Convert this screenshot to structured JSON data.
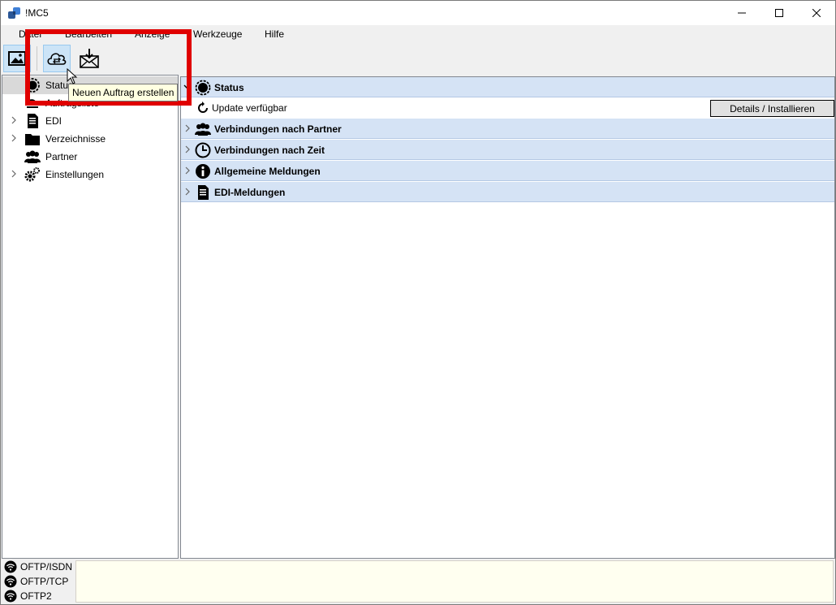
{
  "window": {
    "title": "!MC5"
  },
  "menu": [
    "Datei",
    "Bearbeiten",
    "Anzeige",
    "Werkzeuge",
    "Hilfe"
  ],
  "tooltip": "Neuen Auftrag erstellen",
  "tree": [
    {
      "label": "Status",
      "icon": "status-icon",
      "expandable": false,
      "selected": true
    },
    {
      "label": "Auftragsliste",
      "icon": "order-list-icon",
      "expandable": false
    },
    {
      "label": "EDI",
      "icon": "document-icon",
      "expandable": true
    },
    {
      "label": "Verzeichnisse",
      "icon": "folder-icon",
      "expandable": true
    },
    {
      "label": "Partner",
      "icon": "people-icon",
      "expandable": false
    },
    {
      "label": "Einstellungen",
      "icon": "gears-icon",
      "expandable": true
    }
  ],
  "content": {
    "status_section": "Status",
    "update_label": "Update verfügbar",
    "details_button": "Details / Installieren",
    "sections": [
      {
        "label": "Verbindungen nach Partner",
        "icon": "people-icon"
      },
      {
        "label": "Verbindungen nach Zeit",
        "icon": "clock-icon"
      },
      {
        "label": "Allgemeine Meldungen",
        "icon": "info-icon"
      },
      {
        "label": "EDI-Meldungen",
        "icon": "document-icon"
      }
    ]
  },
  "connections": [
    "OFTP/ISDN",
    "OFTP/TCP",
    "OFTP2"
  ],
  "colors": {
    "highlight": "#e00000",
    "section_bg": "#d5e3f5",
    "tooltip_bg": "#ffffe1",
    "log_bg": "#fffff0"
  }
}
